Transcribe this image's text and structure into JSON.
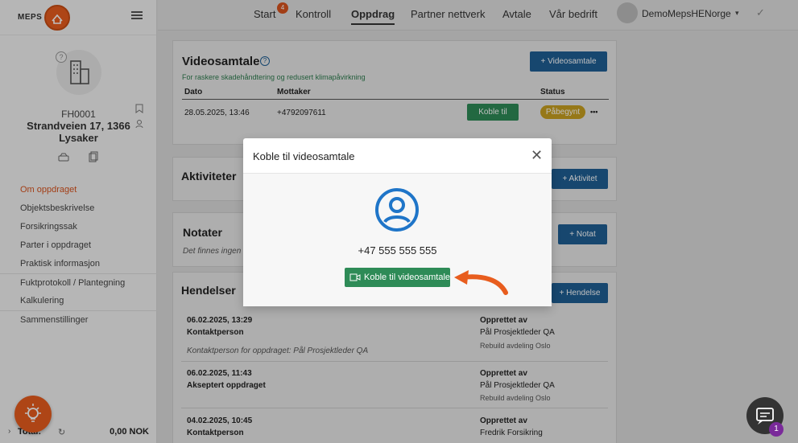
{
  "brand": {
    "logo_text": "MEPS"
  },
  "sidebar": {
    "property_id": "FH0001",
    "address_line1": "Strandveien 17, 1366",
    "address_line2": "Lysaker",
    "nav": [
      {
        "label": "Om oppdraget"
      },
      {
        "label": "Objektsbeskrivelse"
      },
      {
        "label": "Forsikringssak"
      },
      {
        "label": "Parter i oppdraget"
      },
      {
        "label": "Praktisk informasjon"
      },
      {
        "label": "Fuktprotokoll / Plantegning"
      },
      {
        "label": "Kalkulering"
      },
      {
        "label": "Sammenstillinger"
      }
    ],
    "total_label": "Total:",
    "total_value": "0,00 NOK"
  },
  "topnav": {
    "items": [
      "Start",
      "Kontroll",
      "Oppdrag",
      "Partner nettverk",
      "Avtale",
      "Vår bedrift"
    ],
    "start_badge": "4",
    "user_name": "DemoMepsHENorge"
  },
  "video": {
    "title": "Videosamtale",
    "subtitle": "For raskere skadehåndtering og redusert klimapåvirkning",
    "add_button": "+ Videosamtale",
    "columns": [
      "Dato",
      "Mottaker",
      "Status"
    ],
    "row": {
      "date": "28.05.2025, 13:46",
      "receiver": "+4792097611",
      "connect": "Koble til",
      "status": "Påbegynt",
      "more": "•••"
    }
  },
  "aktiviteter": {
    "title": "Aktiviteter",
    "add_button": "+ Aktivitet"
  },
  "notater": {
    "title": "Notater",
    "empty_text": "Det finnes ingen n",
    "add_button": "+ Notat"
  },
  "hendelser": {
    "title": "Hendelser",
    "add_button": "+ Hendelse",
    "created_by_label": "Opprettet av",
    "items": [
      {
        "date": "06.02.2025, 13:29",
        "title": "Kontaktperson",
        "note": "Kontaktperson for oppdraget: Pål Prosjektleder QA",
        "creator": "Pål Prosjektleder QA",
        "dept": "Rebuild avdeling Oslo"
      },
      {
        "date": "06.02.2025, 11:43",
        "title": "Akseptert oppdraget",
        "note": "",
        "creator": "Pål Prosjektleder QA",
        "dept": "Rebuild avdeling Oslo"
      },
      {
        "date": "04.02.2025, 10:45",
        "title": "Kontaktperson",
        "note": "",
        "creator": "Fredrik Forsikring",
        "dept": ""
      }
    ]
  },
  "modal": {
    "title": "Koble til videosamtale",
    "phone": "+47 555 555 555",
    "connect_button": "Koble til videosamtale"
  },
  "chat": {
    "badge": "1"
  },
  "colors": {
    "accent": "#e85d1e",
    "primary": "#1f5f95",
    "success": "#2e8b57",
    "status_badge": "#c8a020"
  }
}
